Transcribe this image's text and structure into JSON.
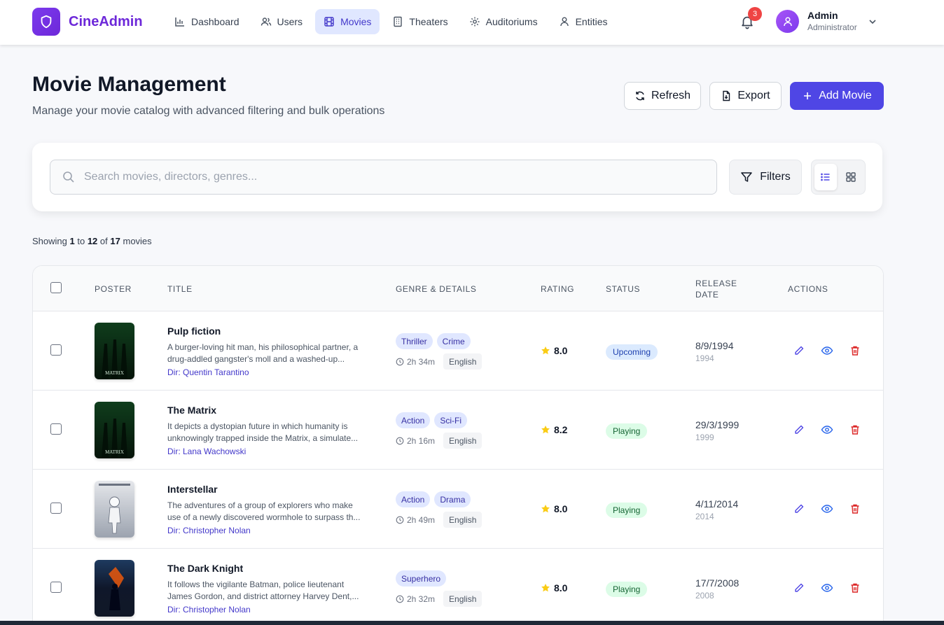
{
  "app": {
    "name": "CineAdmin",
    "brand_color": "#6d28d9",
    "accent": "#4f46e5"
  },
  "nav": {
    "items": [
      {
        "label": "Dashboard",
        "icon": "bar-chart-icon",
        "active": false
      },
      {
        "label": "Users",
        "icon": "users-icon",
        "active": false
      },
      {
        "label": "Movies",
        "icon": "film-icon",
        "active": true
      },
      {
        "label": "Theaters",
        "icon": "building-icon",
        "active": false
      },
      {
        "label": "Auditoriums",
        "icon": "gear-icon",
        "active": false
      },
      {
        "label": "Entities",
        "icon": "user-icon",
        "active": false
      }
    ]
  },
  "notifications": {
    "count": "3"
  },
  "user": {
    "name": "Admin",
    "role": "Administrator"
  },
  "header": {
    "title": "Movie Management",
    "subtitle": "Manage your movie catalog with advanced filtering and bulk operations",
    "refresh_label": "Refresh",
    "export_label": "Export",
    "add_label": "Add Movie"
  },
  "search": {
    "placeholder": "Search movies, directors, genres...",
    "value": ""
  },
  "filters_label": "Filters",
  "pagination": {
    "prefix": "Showing",
    "from": "1",
    "to_word": "to",
    "to": "12",
    "of_word": "of",
    "total": "17",
    "suffix": "movies"
  },
  "table": {
    "headers": {
      "poster": "Poster",
      "title": "Title",
      "genre": "Genre & Details",
      "rating": "Rating",
      "status": "Status",
      "release_line1": "Release",
      "release_line2": "Date",
      "actions": "Actions"
    },
    "rows": [
      {
        "title": "Pulp fiction",
        "desc1": "A burger-loving hit man, his philosophical partner, a",
        "desc2": "drug-addled gangster's moll and a washed-up...",
        "director": "Dir: Quentin Tarantino",
        "genres": [
          "Thriller",
          "Crime"
        ],
        "duration": "2h 34m",
        "language": "English",
        "rating": "8.0",
        "status": "Upcoming",
        "date": "8/9/1994",
        "year": "1994"
      },
      {
        "title": "The Matrix",
        "desc1": "It depicts a dystopian future in which humanity is",
        "desc2": "unknowingly trapped inside the Matrix, a simulate...",
        "director": "Dir: Lana Wachowski",
        "genres": [
          "Action",
          "Sci-Fi"
        ],
        "duration": "2h 16m",
        "language": "English",
        "rating": "8.2",
        "status": "Playing",
        "date": "29/3/1999",
        "year": "1999"
      },
      {
        "title": "Interstellar",
        "desc1": "The adventures of a group of explorers who make",
        "desc2": "use of a newly discovered wormhole to surpass th...",
        "director": "Dir: Christopher Nolan",
        "genres": [
          "Action",
          "Drama"
        ],
        "duration": "2h 49m",
        "language": "English",
        "rating": "8.0",
        "status": "Playing",
        "date": "4/11/2014",
        "year": "2014"
      },
      {
        "title": "The Dark Knight",
        "desc1": "It follows the vigilante Batman, police lieutenant",
        "desc2": "James Gordon, and district attorney Harvey Dent,...",
        "director": "Dir: Christopher Nolan",
        "genres": [
          "Superhero"
        ],
        "duration": "2h 32m",
        "language": "English",
        "rating": "8.0",
        "status": "Playing",
        "date": "17/7/2008",
        "year": "2008"
      }
    ]
  }
}
